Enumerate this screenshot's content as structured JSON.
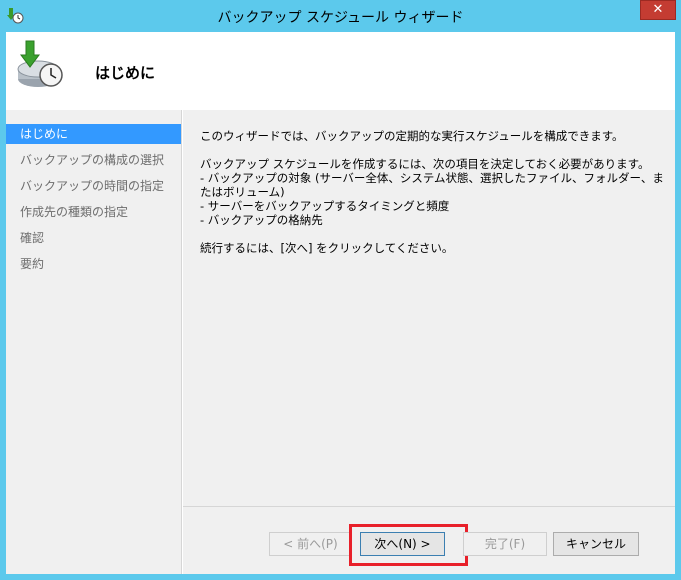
{
  "window": {
    "title": "バックアップ スケジュール ウィザード",
    "close_label": "✕"
  },
  "header": {
    "title": "はじめに"
  },
  "sidebar": {
    "items": [
      {
        "label": "はじめに",
        "active": true
      },
      {
        "label": "バックアップの構成の選択",
        "active": false
      },
      {
        "label": "バックアップの時間の指定",
        "active": false
      },
      {
        "label": "作成先の種類の指定",
        "active": false
      },
      {
        "label": "確認",
        "active": false
      },
      {
        "label": "要約",
        "active": false
      }
    ]
  },
  "content": {
    "intro": "このウィザードでは、バックアップの定期的な実行スケジュールを構成できます。",
    "decide_heading": "バックアップ スケジュールを作成するには、次の項目を決定しておく必要があります。",
    "bullets": [
      "-  バックアップの対象 (サーバー全体、システム状態、選択したファイル、フォルダー、またはボリューム)",
      "-  サーバーをバックアップするタイミングと頻度",
      "-  バックアップの格納先"
    ],
    "continue_text": "続行するには、[次へ] をクリックしてください。"
  },
  "buttons": {
    "back": "< 前へ(P)",
    "next": "次へ(N) >",
    "finish": "完了(F)",
    "cancel": "キャンセル"
  },
  "colors": {
    "titlebar": "#5cc9ec",
    "selection": "#3399ff",
    "highlight": "#e8202a",
    "close": "#c43c32"
  }
}
